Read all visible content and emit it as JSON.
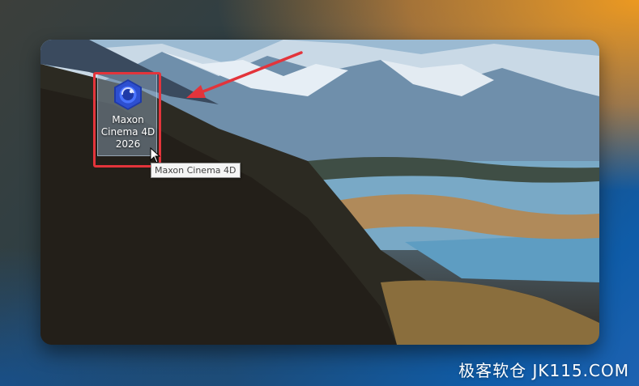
{
  "desktop_icon": {
    "label_line1": "Maxon",
    "label_line2": "Cinema 4D",
    "label_line3": "2026",
    "tooltip": "Maxon Cinema 4D",
    "icon_name": "cinema4d-app-icon"
  },
  "annotation": {
    "highlight_color": "#e3343b",
    "arrow_color": "#e3343b"
  },
  "watermark": {
    "text": "极客软仓 JK115.COM"
  }
}
